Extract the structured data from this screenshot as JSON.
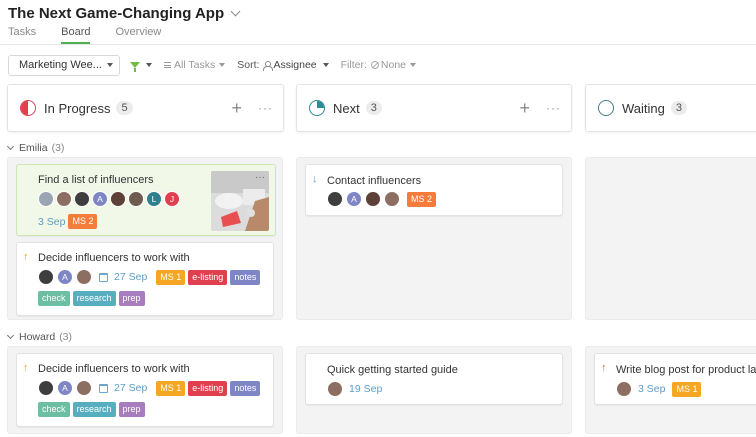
{
  "app": {
    "title": "The Next Game-Changing App"
  },
  "tabs": [
    {
      "label": "Tasks",
      "active": false
    },
    {
      "label": "Board",
      "active": true
    },
    {
      "label": "Overview",
      "active": false
    }
  ],
  "toolbar": {
    "sprint_label": "Marketing Wee...",
    "tasks_label": "All Tasks",
    "sort_label": "Sort:",
    "sort_value": "Assignee",
    "filter_label": "Filter:",
    "filter_value": "None"
  },
  "columns": [
    {
      "name": "In Progress",
      "count": "5",
      "icon": "in-progress-icon",
      "color": "#e0404e"
    },
    {
      "name": "Next",
      "count": "3",
      "icon": "next-icon",
      "color": "#2e8a96"
    },
    {
      "name": "Waiting",
      "count": "3",
      "icon": "waiting-icon",
      "color": "#4a7a84"
    }
  ],
  "groups": [
    {
      "name": "Emilia",
      "count": "(3)",
      "cards": {
        "c1": {
          "title": "Find a list of influencers",
          "date": "3 Sep",
          "tags": [
            "MS 2"
          ],
          "avatars": [
            "",
            "",
            "",
            "A",
            "",
            "",
            "L",
            "J"
          ]
        },
        "c2": {
          "title": "Decide influencers to work with",
          "priority": "↑",
          "date": "27 Sep",
          "tags": [
            "MS 1",
            "e-listing",
            "notes",
            "check",
            "research",
            "prep"
          ],
          "avatars": [
            "",
            "A",
            ""
          ]
        },
        "c3": {
          "title": "Contact influencers",
          "priority": "↓",
          "tags": [
            "MS 2"
          ],
          "avatars": [
            "",
            "A",
            "",
            ""
          ]
        }
      }
    },
    {
      "name": "Howard",
      "count": "(3)",
      "cards": {
        "c1": {
          "title": "Decide influencers to work with",
          "priority": "↑",
          "date": "27 Sep",
          "tags": [
            "MS 1",
            "e-listing",
            "notes",
            "check",
            "research",
            "prep"
          ],
          "avatars": [
            "",
            "A",
            ""
          ]
        },
        "c2": {
          "title": "Quick getting started guide",
          "date": "19 Sep",
          "avatars": [
            ""
          ]
        },
        "c3": {
          "title": "Write blog post for product lau",
          "priority": "↑",
          "date": "3 Sep",
          "tags": [
            "MS 1"
          ],
          "avatars": [
            ""
          ]
        }
      }
    }
  ],
  "colors": {
    "accent_green": "#4caf50",
    "tag_ms1": "#f5a623",
    "tag_ms2": "#f57c3a",
    "tag_elisting": "#e0404e",
    "tag_notes": "#7f86c6",
    "tag_check": "#6cbfa3",
    "tag_research": "#56aebf",
    "tag_prep": "#a77dc0",
    "priority_up": "#f0a030",
    "priority_down": "#5aa3c8",
    "date_text": "#5a9ec9"
  }
}
